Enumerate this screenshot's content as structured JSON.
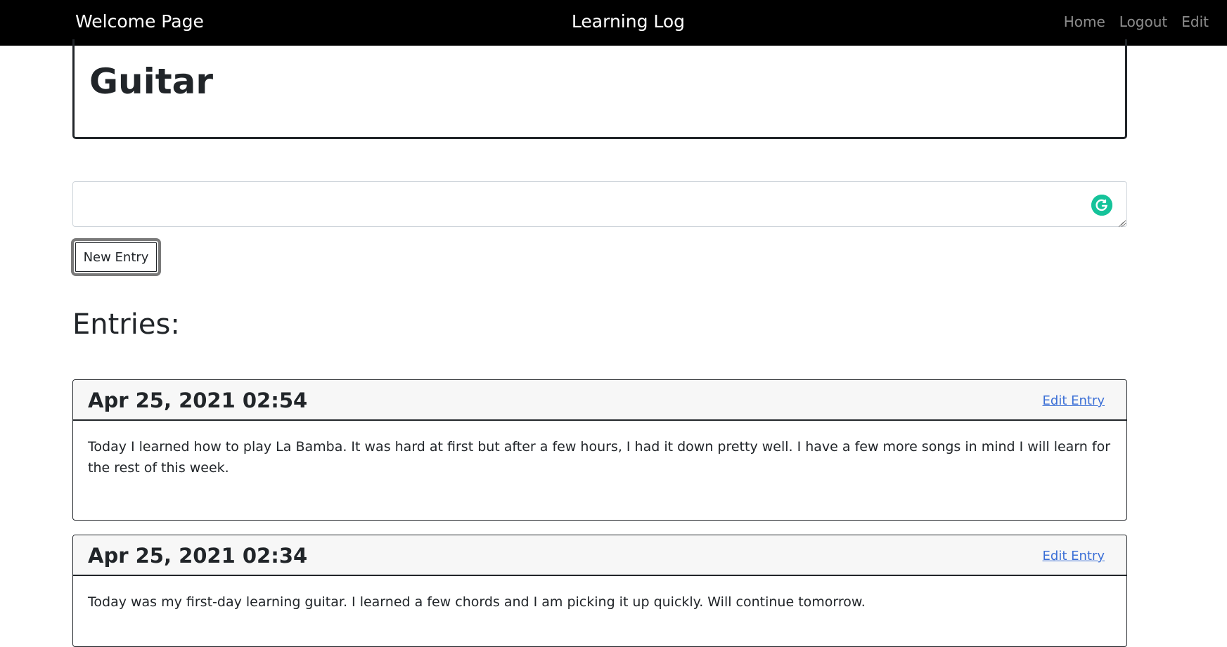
{
  "navbar": {
    "brand": "Welcome Page",
    "title": "Learning Log",
    "links": {
      "home": "Home",
      "logout": "Logout",
      "edit": "Edit"
    }
  },
  "topic": {
    "title": "Guitar"
  },
  "new_entry_form": {
    "textarea_value": "",
    "button_label": "New Entry"
  },
  "entries_heading": "Entries:",
  "entries": [
    {
      "date": "Apr 25, 2021 02:54",
      "edit_label": "Edit Entry",
      "text": "Today I learned how to play La Bamba. It was hard at first but after a few hours, I had it down pretty well. I have a few more songs in mind I will learn for the rest of this week."
    },
    {
      "date": "Apr 25, 2021 02:34",
      "edit_label": "Edit Entry",
      "text": "Today was my first-day learning guitar. I learned a few chords and I am picking it up quickly. Will continue tomorrow."
    }
  ],
  "colors": {
    "navbar_bg": "#000000",
    "link_blue": "#3b6fd6",
    "card_header_bg": "#f7f7f7",
    "grammarly_green": "#15c39a"
  },
  "icons": {
    "grammarly": "grammarly-icon",
    "resize": "resize-grip-icon"
  }
}
